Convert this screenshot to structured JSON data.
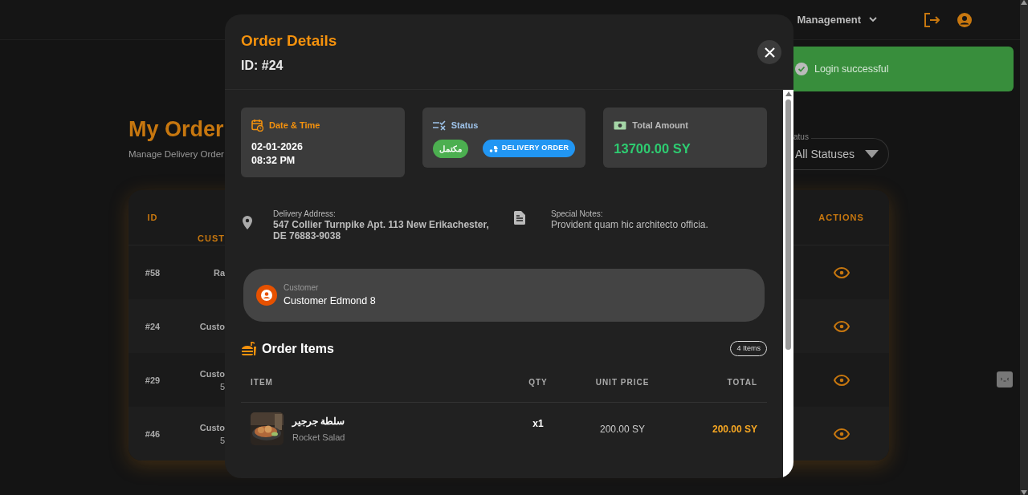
{
  "navbar": {
    "menu": "Management"
  },
  "toast": {
    "text": "Login successful"
  },
  "page": {
    "title": "My Order",
    "subtitle": "Manage Delivery Order",
    "filter": {
      "label": "atus",
      "value": "All Statuses"
    }
  },
  "orders_table": {
    "columns": [
      "ID",
      "CUST",
      "ACTIONS"
    ],
    "rows": [
      {
        "id": "#58",
        "customer": "Ra"
      },
      {
        "id": "#24",
        "customer": "Custo"
      },
      {
        "id": "#29",
        "customer": "Custo",
        "line_2": "5"
      },
      {
        "id": "#46",
        "customer": "Custo",
        "line_2": "5"
      }
    ]
  },
  "modal": {
    "title": "Order Details",
    "order_id": "ID: #24",
    "cards": [
      {
        "kind": "datetime",
        "label": "Date & Time",
        "lines": [
          "02-01-2026",
          "08:32 PM"
        ]
      },
      {
        "kind": "status",
        "label": "Status",
        "status": "مكتمل",
        "order_type": "DELIVERY ORDER"
      },
      {
        "kind": "amount",
        "label": "Total Amount",
        "value": "13700.00 SY"
      }
    ],
    "address": {
      "label": "Delivery Address:",
      "value": "547 Collier Turnpike Apt. 113 New Erikachester, DE 76883-9038"
    },
    "notes": {
      "label": "Special Notes:",
      "value": "Provident quam hic architecto officia."
    },
    "customer": {
      "label": "Customer",
      "name": "Customer Edmond 8"
    },
    "items": {
      "title": "Order Items",
      "count": "4 Items",
      "columns": [
        "ITEM",
        "QTY",
        "UNIT PRICE",
        "TOTAL"
      ],
      "rows": [
        {
          "name": "سلطة جرجير",
          "subtitle": "Rocket Salad",
          "qty": "x1",
          "unit_price": "200.00 SY",
          "total": "200.00 SY"
        }
      ]
    }
  }
}
